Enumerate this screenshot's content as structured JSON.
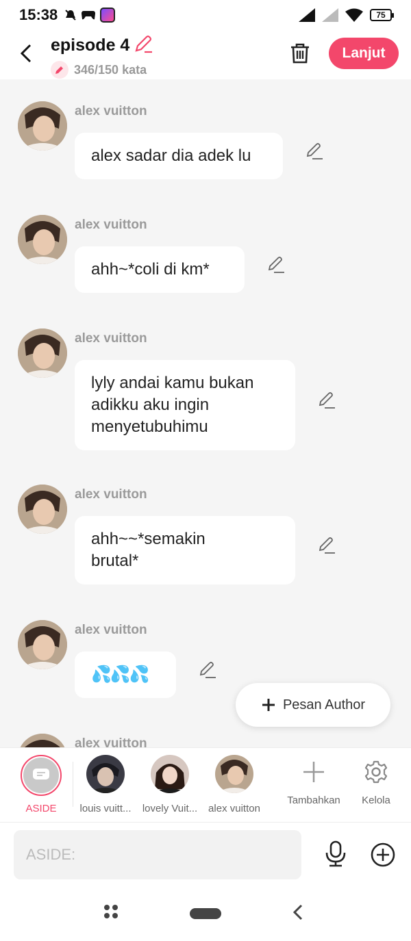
{
  "status_bar": {
    "time": "15:38",
    "battery": "75",
    "icons": [
      "dnd-icon",
      "game-icon",
      "app-icon",
      "signal-icon",
      "signal-weak-icon",
      "wifi-icon",
      "battery-icon"
    ]
  },
  "header": {
    "title": "episode 4",
    "word_count": "346/150 kata",
    "next_label": "Lanjut",
    "accent_color": "#f3476b"
  },
  "messages": [
    {
      "sender": "alex vuitton",
      "lines": [
        "alex sadar dia adek lu"
      ]
    },
    {
      "sender": "alex vuitton",
      "lines": [
        "ahh~*coli di km*"
      ]
    },
    {
      "sender": "alex vuitton",
      "lines": [
        "lyly andai kamu bukan",
        "adikku aku ingin",
        "menyetubuhimu"
      ]
    },
    {
      "sender": "alex vuitton",
      "lines": [
        "ahh~~*semakin",
        "brutal*"
      ]
    },
    {
      "sender": "alex vuitton",
      "lines": [
        "💦💦💦"
      ]
    },
    {
      "sender": "alex vuitton",
      "lines": []
    }
  ],
  "pesan_author": "Pesan Author",
  "characters": {
    "aside": "ASIDE",
    "items": [
      "louis vuitt...",
      "lovely Vuit...",
      "alex vuitton"
    ],
    "add_label": "Tambahkan",
    "manage_label": "Kelola"
  },
  "input": {
    "placeholder": "ASIDE:"
  }
}
